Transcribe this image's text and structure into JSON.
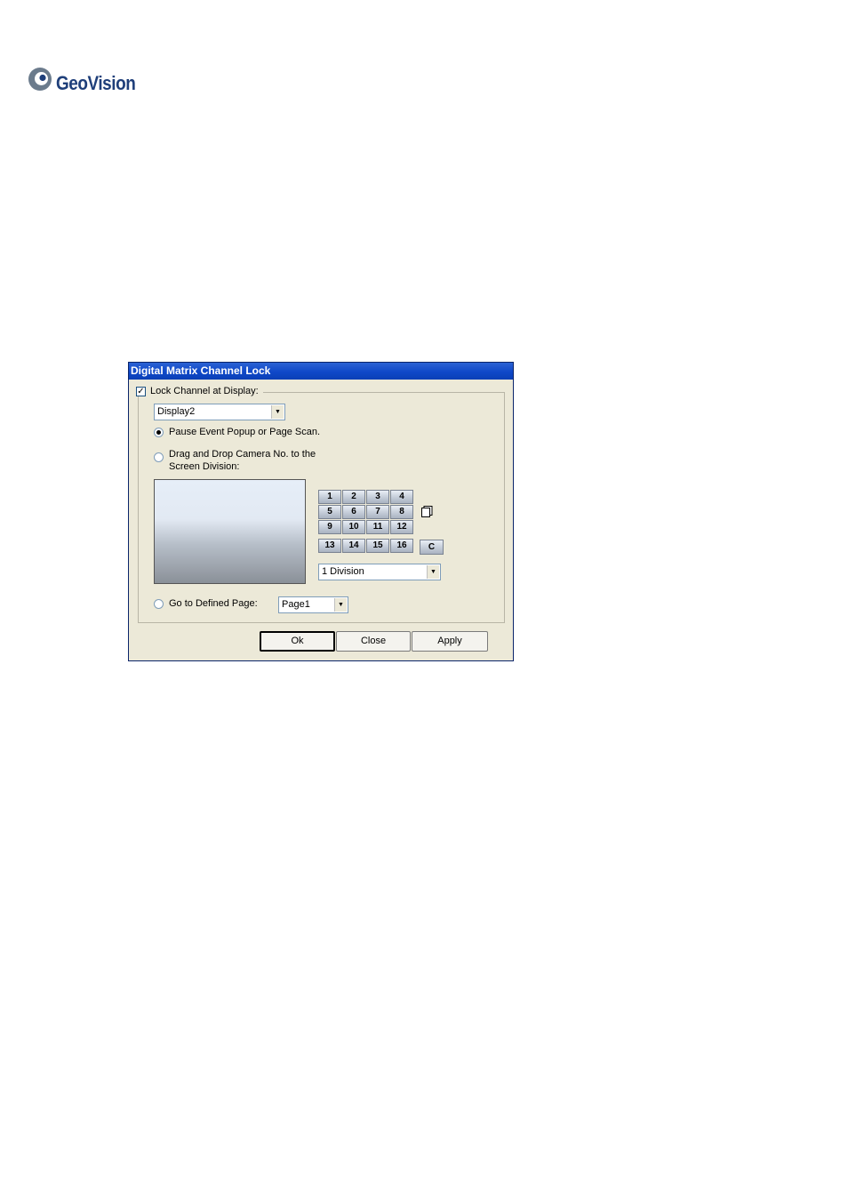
{
  "logo": {
    "text": "GeoVision"
  },
  "dialog": {
    "title": "Digital Matrix Channel Lock",
    "lock_channel": {
      "label": "Lock Channel at Display:",
      "checked": true
    },
    "display_select": {
      "value": "Display2"
    },
    "option_pause": {
      "label": "Pause Event Popup or Page Scan.",
      "selected": true
    },
    "option_drag": {
      "label_line1": "Drag and Drop Camera No. to the",
      "label_line2": "Screen Division:",
      "selected": false
    },
    "camera_numbers": [
      "1",
      "2",
      "3",
      "4",
      "5",
      "6",
      "7",
      "8",
      "9",
      "10",
      "11",
      "12"
    ],
    "camera_numbers_row4": [
      "13",
      "14",
      "15",
      "16"
    ],
    "clear_button": "C",
    "division_select": {
      "value": "1 Division"
    },
    "option_goto": {
      "label": "Go to Defined Page:",
      "selected": false
    },
    "page_select": {
      "value": "Page1"
    },
    "buttons": {
      "ok": "Ok",
      "close": "Close",
      "apply": "Apply"
    }
  }
}
